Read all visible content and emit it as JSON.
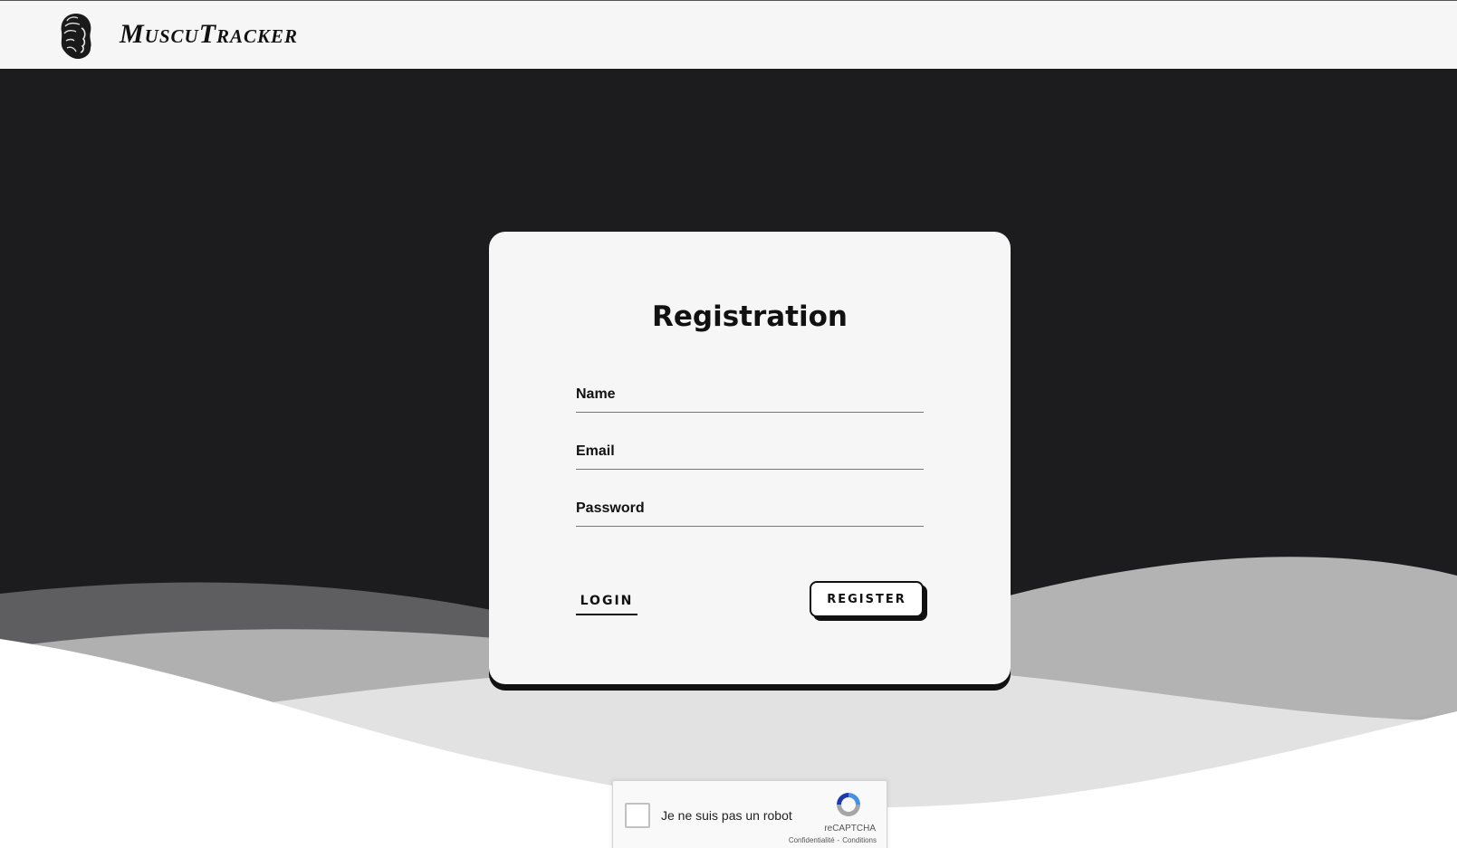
{
  "navbar": {
    "brand": "MuscuTracker",
    "logo_icon": "greek-head-logo-icon"
  },
  "form": {
    "title": "Registration",
    "name_placeholder": "Name",
    "email_placeholder": "Email",
    "password_placeholder": "Password",
    "login_label": "LOGIN",
    "register_label": "REGISTER"
  },
  "recaptcha": {
    "label": "Je ne suis pas un robot",
    "brand": "reCAPTCHA",
    "privacy": "Confidentialité",
    "separator": "-",
    "terms": "Conditions",
    "icon": "recaptcha-icon"
  },
  "colors": {
    "background": "#1c1c1e",
    "card": "#f6f6f6",
    "navbar": "#f6f6f6",
    "wave_dark": "#5e5e60",
    "wave_mid": "#b0b0b0",
    "wave_light": "#e0e0e0",
    "wave_white": "#ffffff"
  }
}
